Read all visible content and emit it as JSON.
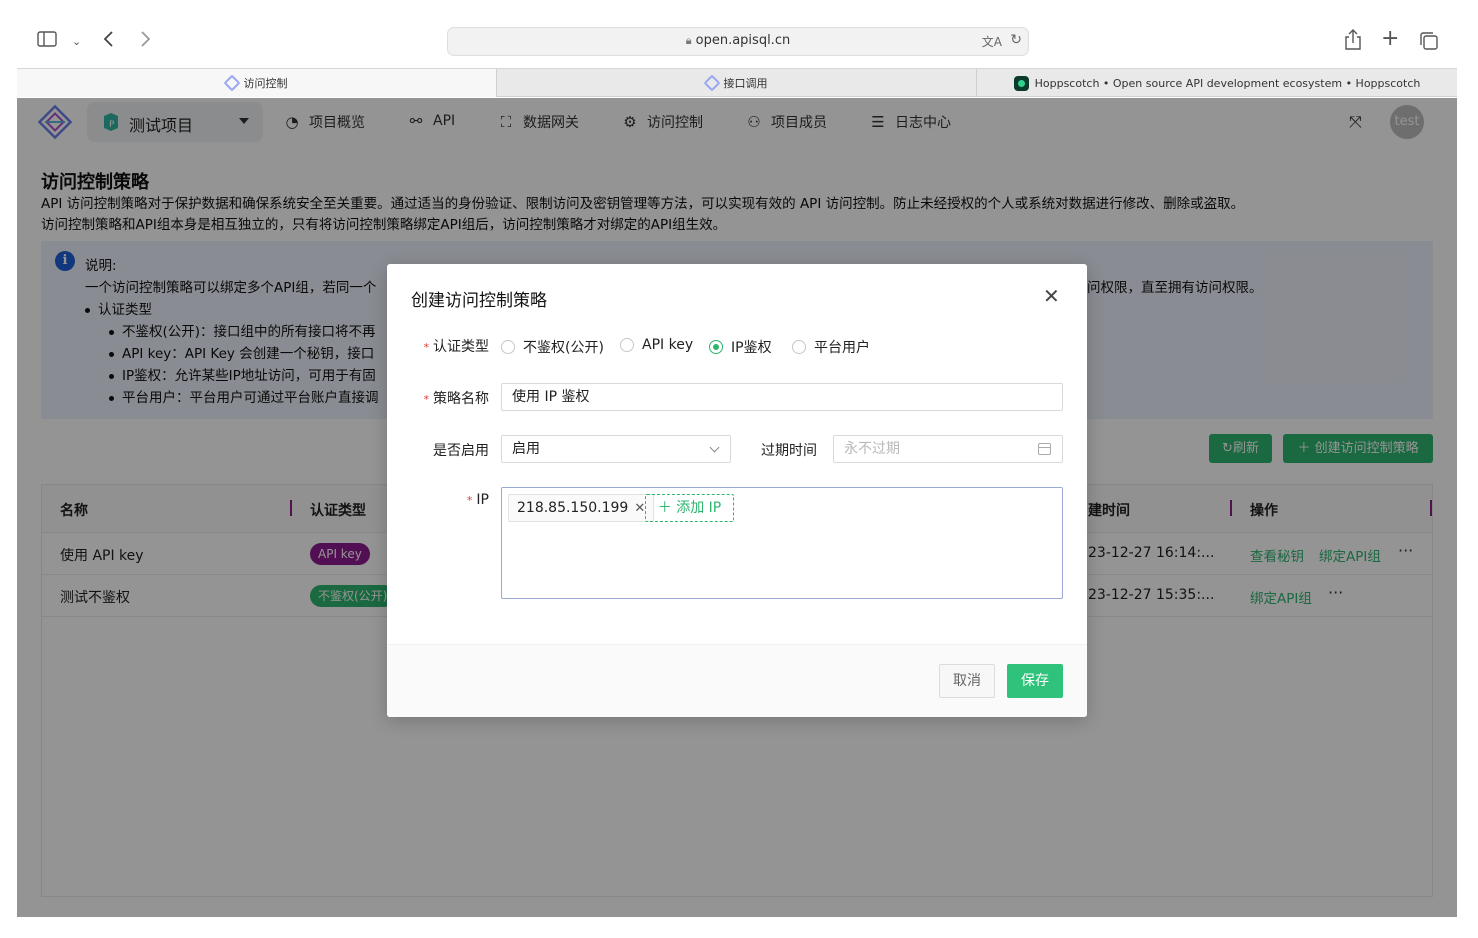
{
  "browser": {
    "url": "open.apisql.cn",
    "tabs": [
      {
        "label": "访问控制",
        "active": true
      },
      {
        "label": "接口调用",
        "active": false
      },
      {
        "label": "Hoppscotch • Open source API development ecosystem • Hoppscotch",
        "active": false
      }
    ]
  },
  "nav": {
    "project": "测试项目",
    "items": [
      {
        "label": "项目概览",
        "icon": "dashboard-icon"
      },
      {
        "label": "API",
        "icon": "api-link-icon"
      },
      {
        "label": "数据网关",
        "icon": "gateway-icon"
      },
      {
        "label": "访问控制",
        "icon": "gear-icon"
      },
      {
        "label": "项目成员",
        "icon": "members-icon"
      },
      {
        "label": "日志中心",
        "icon": "log-icon"
      }
    ],
    "avatar": "test"
  },
  "page": {
    "title": "访问控制策略",
    "desc1": "API 访问控制策略对于保护数据和确保系统安全至关重要。通过适当的身份验证、限制访问及密钥管理等方法，可以实现有效的 API 访问控制。防止未经授权的个人或系统对数据进行修改、删除或盗取。",
    "desc2": "访问控制策略和API组本身是相互独立的，只有将访问控制策略绑定API组后，访问控制策略才对绑定的API组生效。"
  },
  "info": {
    "heading": "说明:",
    "line1": "一个访问控制策略可以绑定多个API组，若同一个",
    "line1_tail": "问权限，直至拥有访问权限。",
    "bullet": "认证类型",
    "sub": [
      "不鉴权(公开)：接口组中的所有接口将不再",
      "API key：API Key 会创建一个秘钥，接口",
      "IP鉴权：允许某些IP地址访问，可用于有固",
      "平台用户：平台用户可通过平台账户直接调"
    ]
  },
  "actions": {
    "refresh": "刷新",
    "create": "创建访问控制策略"
  },
  "table": {
    "columns": [
      "名称",
      "认证类型",
      "建时间",
      "操作"
    ],
    "rows": [
      {
        "name": "使用 API key",
        "type": "API key",
        "type_color": "#8f1a8f",
        "created": "23-12-27 16:14:...",
        "actions": [
          "查看秘钥",
          "绑定API组"
        ]
      },
      {
        "name": "测试不鉴权",
        "type": "不鉴权(公开)",
        "type_color": "#2db56e",
        "created": "23-12-27 15:35:...",
        "actions": [
          "绑定API组"
        ]
      }
    ],
    "more": "···"
  },
  "modal": {
    "title": "创建访问控制策略",
    "auth_label": "认证类型",
    "auth_options": [
      "不鉴权(公开)",
      "API key",
      "IP鉴权",
      "平台用户"
    ],
    "auth_selected": "IP鉴权",
    "name_label": "策略名称",
    "name_value": "使用 IP 鉴权",
    "enable_label": "是否启用",
    "enable_value": "启用",
    "expire_label": "过期时间",
    "expire_placeholder": "永不过期",
    "ip_label": "IP",
    "ip_tags": [
      "218.85.150.199"
    ],
    "ip_add": "添加 IP",
    "cancel": "取消",
    "save": "保存"
  },
  "colors": {
    "accent": "#2db56e",
    "info_bg": "#edf1fb",
    "api_key_badge": "#8f1a8f"
  }
}
